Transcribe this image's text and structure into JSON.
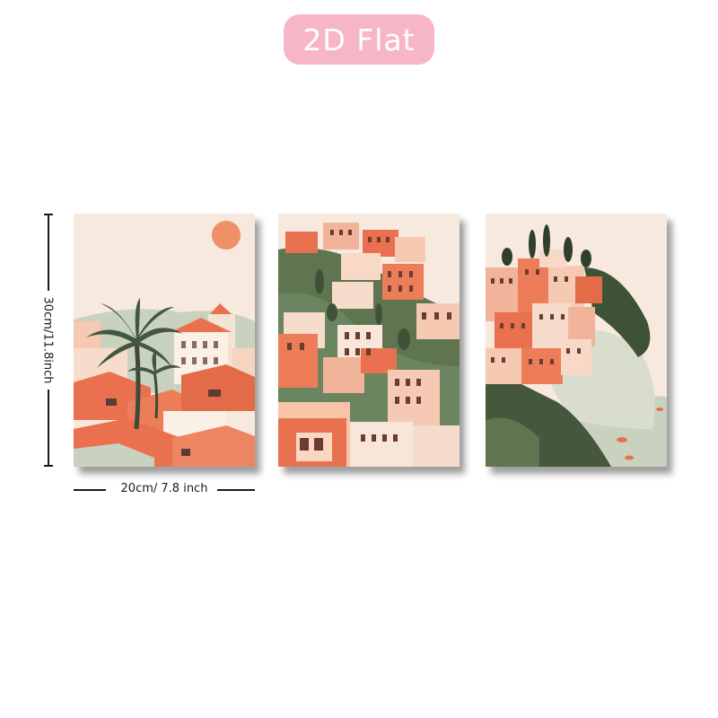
{
  "badge": {
    "label": "2D Flat",
    "color": "#f7b6c8"
  },
  "dimensions": {
    "height_label": "30cm/11.8inch",
    "width_label": "20cm/ 7.8 inch"
  },
  "posters": [
    {
      "subject": "rooftops with palm tree and sun"
    },
    {
      "subject": "hillside town with pink and orange houses"
    },
    {
      "subject": "cliffside village above the sea"
    }
  ],
  "palette": {
    "cream": "#f8e9de",
    "coral": "#e9714f",
    "pink": "#f2b39b",
    "green": "#5e7550",
    "sage": "#c9d2be"
  }
}
